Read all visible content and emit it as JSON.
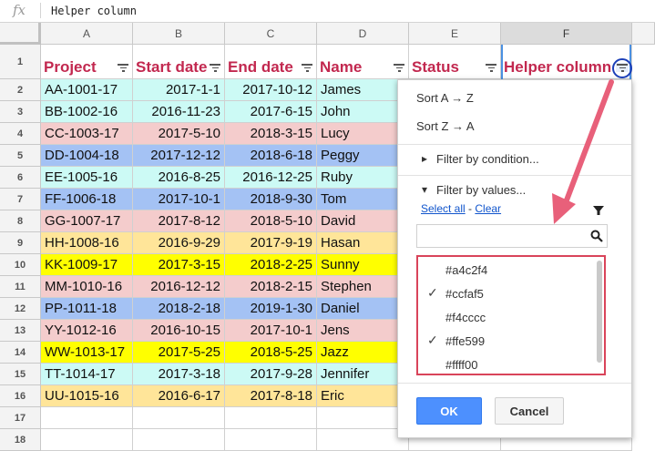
{
  "formula_bar": {
    "fx_label": "fx",
    "content": "Helper column"
  },
  "columns": [
    "A",
    "B",
    "C",
    "D",
    "E",
    "F"
  ],
  "rows": [
    "1",
    "2",
    "3",
    "4",
    "5",
    "6",
    "7",
    "8",
    "9",
    "10",
    "11",
    "12",
    "13",
    "14",
    "15",
    "16",
    "17",
    "18"
  ],
  "headers": [
    "Project",
    "Start date",
    "End date",
    "Name",
    "Status",
    "Helper column"
  ],
  "data_rows": [
    {
      "project": "AA-1001-17",
      "start": "2017-1-1",
      "end": "2017-10-12",
      "name": "James",
      "color": "#ccfaf5"
    },
    {
      "project": "BB-1002-16",
      "start": "2016-11-23",
      "end": "2017-6-15",
      "name": "John",
      "color": "#ccfaf5"
    },
    {
      "project": "CC-1003-17",
      "start": "2017-5-10",
      "end": "2018-3-15",
      "name": "Lucy",
      "color": "#f4cccc"
    },
    {
      "project": "DD-1004-18",
      "start": "2017-12-12",
      "end": "2018-6-18",
      "name": "Peggy",
      "color": "#a4c2f4"
    },
    {
      "project": "EE-1005-16",
      "start": "2016-8-25",
      "end": "2016-12-25",
      "name": "Ruby",
      "color": "#ccfaf5"
    },
    {
      "project": "FF-1006-18",
      "start": "2017-10-1",
      "end": "2018-9-30",
      "name": "Tom",
      "color": "#a4c2f4"
    },
    {
      "project": "GG-1007-17",
      "start": "2017-8-12",
      "end": "2018-5-10",
      "name": "David",
      "color": "#f4cccc"
    },
    {
      "project": "HH-1008-16",
      "start": "2016-9-29",
      "end": "2017-9-19",
      "name": "Hasan",
      "color": "#ffe599"
    },
    {
      "project": "KK-1009-17",
      "start": "2017-3-15",
      "end": "2018-2-25",
      "name": "Sunny",
      "color": "#ffff00"
    },
    {
      "project": "MM-1010-16",
      "start": "2016-12-12",
      "end": "2018-2-15",
      "name": "Stephen",
      "color": "#f4cccc"
    },
    {
      "project": "PP-1011-18",
      "start": "2018-2-18",
      "end": "2019-1-30",
      "name": "Daniel",
      "color": "#a4c2f4"
    },
    {
      "project": "YY-1012-16",
      "start": "2016-10-15",
      "end": "2017-10-1",
      "name": "Jens",
      "color": "#f4cccc"
    },
    {
      "project": "WW-1013-17",
      "start": "2017-5-25",
      "end": "2018-5-25",
      "name": "Jazz",
      "color": "#ffff00"
    },
    {
      "project": "TT-1014-17",
      "start": "2017-3-18",
      "end": "2017-9-28",
      "name": "Jennifer",
      "color": "#ccfaf5"
    },
    {
      "project": "UU-1015-16",
      "start": "2016-6-17",
      "end": "2017-8-18",
      "name": "Eric",
      "color": "#ffe599"
    }
  ],
  "filter_panel": {
    "sort_az": "Sort A → Z",
    "sort_za": "Sort Z → A",
    "by_condition": "Filter by condition...",
    "by_values": "Filter by values...",
    "select_all": "Select all",
    "separator": " - ",
    "clear": "Clear",
    "search_placeholder": "",
    "values": [
      {
        "label": "#a4c2f4",
        "checked": false
      },
      {
        "label": "#ccfaf5",
        "checked": true
      },
      {
        "label": "#f4cccc",
        "checked": false
      },
      {
        "label": "#ffe599",
        "checked": true
      },
      {
        "label": "#ffff00",
        "checked": false
      }
    ],
    "ok_label": "OK",
    "cancel_label": "Cancel"
  },
  "colors": {
    "header_text": "#c2284f",
    "accent_blue": "#4d90fe",
    "annotation_red": "#d9445a"
  }
}
